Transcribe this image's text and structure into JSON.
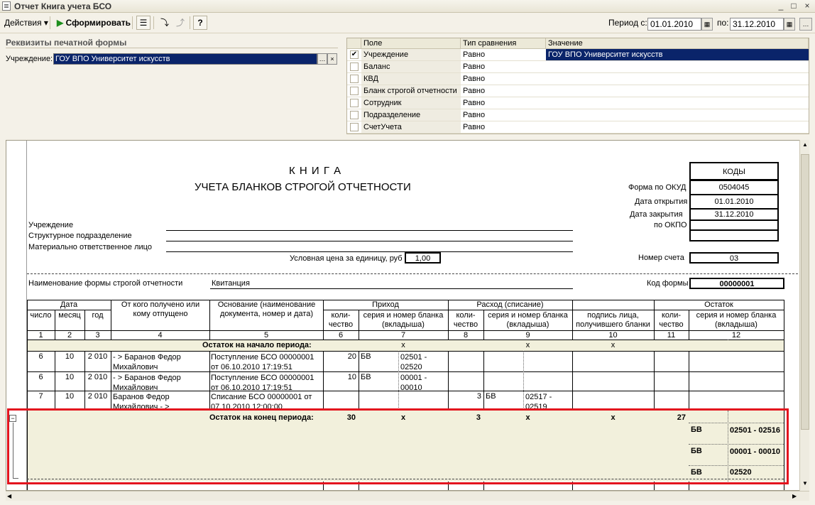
{
  "window": {
    "title": "Отчет  Книга учета БСО",
    "buttons": [
      "_",
      "□",
      "×"
    ]
  },
  "toolbar": {
    "actions_label": "Действия",
    "generate_label": "Сформировать",
    "help_label": "?",
    "period_from_label": "Период с:",
    "period_from_value": "01.01.2010",
    "period_to_label": "по:",
    "period_to_value": "31.12.2010"
  },
  "requisites": {
    "title": "Реквизиты печатной формы",
    "institution_label": "Учреждение:",
    "institution_value": "ГОУ ВПО Университет искусств"
  },
  "filter": {
    "columns": [
      "Поле",
      "Тип сравнения",
      "Значение"
    ],
    "rows": [
      {
        "checked": "✔",
        "field": "Учреждение",
        "cmp": "Равно",
        "value": "ГОУ ВПО Университет искусств"
      },
      {
        "checked": "",
        "field": "Баланс",
        "cmp": "Равно",
        "value": ""
      },
      {
        "checked": "",
        "field": "КВД",
        "cmp": "Равно",
        "value": ""
      },
      {
        "checked": "",
        "field": "Бланк строгой отчетности",
        "cmp": "Равно",
        "value": ""
      },
      {
        "checked": "",
        "field": "Сотрудник",
        "cmp": "Равно",
        "value": ""
      },
      {
        "checked": "",
        "field": "Подразделение",
        "cmp": "Равно",
        "value": ""
      },
      {
        "checked": "",
        "field": "СчетУчета",
        "cmp": "Равно",
        "value": ""
      }
    ]
  },
  "report": {
    "title1": "К Н И Г А",
    "title2": "УЧЕТА БЛАНКОВ СТРОГОЙ ОТЧЕТНОСТИ",
    "codes_header": "КОДЫ",
    "okud_label": "Форма по ОКУД",
    "okud_value": "0504045",
    "open_label": "Дата открытия",
    "open_value": "01.01.2010",
    "close_label": "Дата закрытия",
    "close_value": "31.12.2010",
    "okpo_label": "по ОКПО",
    "inst_label": "Учреждение",
    "dept_label": "Структурное подразделение",
    "resp_label": "Материально ответственное лицо",
    "price_label": "Условная цена за единицу, руб",
    "price_value": "1,00",
    "account_label": "Номер счета",
    "account_value": "03",
    "form_name_label": "Наименование формы строгой отчетности",
    "form_name_value": "Квитанция",
    "form_code_label": "Код формы",
    "form_code_value": "00000001",
    "headers": {
      "date": "Дата",
      "day": "число",
      "month": "месяц",
      "year": "год",
      "from": "От кого получено или кому отпущено",
      "basis": "Основание (наименование документа, номер и дата)",
      "income": "Приход",
      "expense": "Расход (списание)",
      "balance": "Остаток",
      "qty": "коли-чество",
      "series": "серия и номер бланка (вкладыша)",
      "sign": "подпись лица, получившего бланки",
      "nums": [
        "1",
        "2",
        "3",
        "4",
        "5",
        "6",
        "7",
        "8",
        "9",
        "10",
        "11",
        "12"
      ]
    },
    "opening": {
      "label": "Остаток на начало периода:",
      "x": "x"
    },
    "rows": [
      {
        "day": "6",
        "month": "10",
        "year": "2 010",
        "who": "- > Баранов Федор Михайлович",
        "basis": "Поступление БСО 00000001 от 06.10.2010 17:19:51",
        "in_qty": "20",
        "in_ser": "БВ",
        "in_num": "02501 - 02520",
        "out_qty": "",
        "out_ser": "",
        "out_num": ""
      },
      {
        "day": "6",
        "month": "10",
        "year": "2 010",
        "who": "- > Баранов Федор Михайлович",
        "basis": "Поступление БСО 00000001 от 06.10.2010 17:19:51",
        "in_qty": "10",
        "in_ser": "БВ",
        "in_num": "00001 - 00010",
        "out_qty": "",
        "out_ser": "",
        "out_num": ""
      },
      {
        "day": "7",
        "month": "10",
        "year": "2 010",
        "who": "Баранов Федор Михайлович - >",
        "basis": "Списание БСО 00000001 от 07.10.2010 12:00:00",
        "in_qty": "",
        "in_ser": "",
        "in_num": "",
        "out_qty": "3",
        "out_ser": "БВ",
        "out_num": "02517 - 02519"
      }
    ],
    "closing": {
      "label": "Остаток на конец периода:",
      "in_qty": "30",
      "out_qty": "3",
      "bal_qty": "27",
      "x": "x",
      "bal_rows": [
        {
          "ser": "БВ",
          "num": "02501 - 02516"
        },
        {
          "ser": "БВ",
          "num": "00001 - 00010"
        },
        {
          "ser": "БВ",
          "num": "02520"
        }
      ]
    },
    "collapse_symbol": "−"
  }
}
